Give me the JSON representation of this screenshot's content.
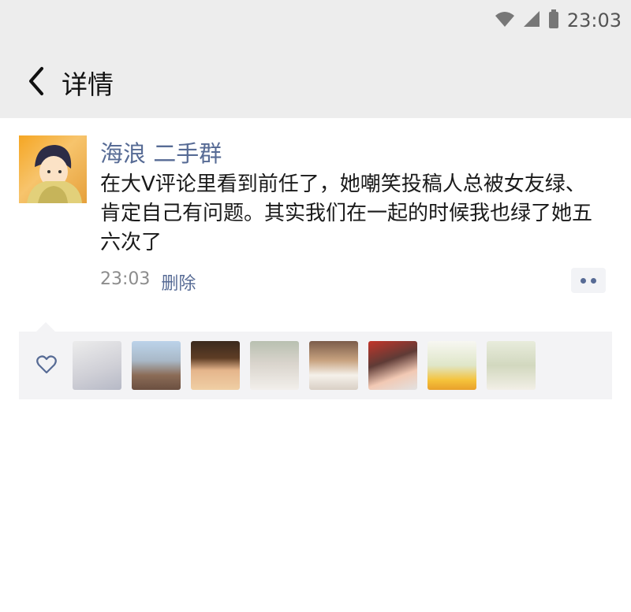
{
  "status_bar": {
    "time": "23:03",
    "icons": [
      "wifi-icon",
      "signal-icon",
      "battery-icon"
    ]
  },
  "nav": {
    "title": "详情",
    "back_icon": "chevron-left-icon"
  },
  "post": {
    "username": "海浪 二手群",
    "content": "在大V评论里看到前任了，她嘲笑投稿人总被女友绿、肯定自己有问题。其实我们在一起的时候我也绿了她五六次了",
    "time": "23:03",
    "delete_label": "删除",
    "more_icon": "more-dots-icon"
  },
  "likes": {
    "icon": "heart-icon",
    "avatars": [
      {
        "name": "avatar-anime-girl-white-hair"
      },
      {
        "name": "avatar-town-street"
      },
      {
        "name": "avatar-anime-boy-headphones"
      },
      {
        "name": "avatar-cat-meme"
      },
      {
        "name": "avatar-dog-shiba"
      },
      {
        "name": "avatar-anime-manga-cover"
      },
      {
        "name": "avatar-illustration-chick"
      },
      {
        "name": "avatar-illustration-rocking-chair"
      }
    ]
  },
  "colors": {
    "link": "#576b95",
    "topbar_bg": "#ededed",
    "likes_bg": "#f3f3f5"
  }
}
